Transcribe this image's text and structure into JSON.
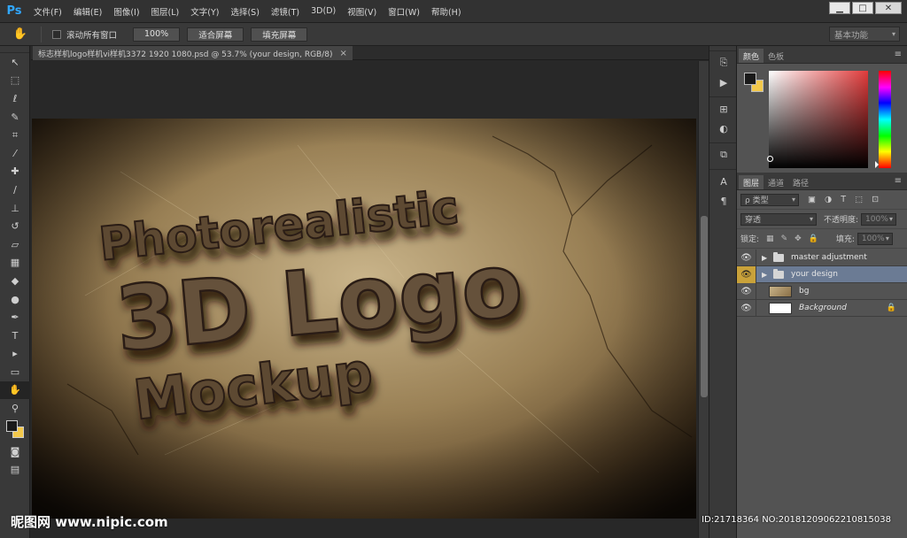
{
  "app": {
    "logo": "Ps",
    "menu": [
      "文件(F)",
      "编辑(E)",
      "图像(I)",
      "图层(L)",
      "文字(Y)",
      "选择(S)",
      "滤镜(T)",
      "3D(D)",
      "视图(V)",
      "窗口(W)",
      "帮助(H)"
    ],
    "window_controls": {
      "minimize": "▁",
      "restore": "□",
      "close": "✕"
    }
  },
  "options_bar": {
    "scroll_all_label": "滚动所有窗口",
    "zoom_100": "100%",
    "fit_screen": "适合屏幕",
    "fill_screen": "填充屏幕",
    "workspace": "基本功能"
  },
  "document": {
    "tab_title": "标志样机logo样机vi样机3372 1920 1080.psd @ 53.7% (your design, RGB/8)",
    "close": "×"
  },
  "artwork": {
    "line1": "Photorealistic",
    "line2": "3D Logo",
    "line3": "Mockup"
  },
  "panels": {
    "color_tabs": [
      "颜色",
      "色板"
    ],
    "layers_tabs": [
      "图层",
      "通道",
      "路径"
    ],
    "kind_label": "ρ 类型",
    "blend_mode": "穿透",
    "opacity_label": "不透明度:",
    "opacity_value": "100%",
    "lock_label": "锁定:",
    "fill_label": "填充:",
    "fill_value": "100%",
    "menu_icon": "≡"
  },
  "layers": [
    {
      "name": "master adjustment",
      "type": "group",
      "selected": false
    },
    {
      "name": "your design",
      "type": "group",
      "selected": true
    },
    {
      "name": "bg",
      "type": "image",
      "selected": false
    },
    {
      "name": "Background",
      "type": "background",
      "selected": false
    }
  ],
  "watermark": {
    "site": "昵图网 www.nipic.com",
    "id": "ID:21718364 NO:20181209062210815038"
  },
  "colors": {
    "foreground": "#1a1a1a",
    "background": "#f2c84b",
    "selection": "#6b7b94",
    "eye_selected": "#c9a23a"
  }
}
